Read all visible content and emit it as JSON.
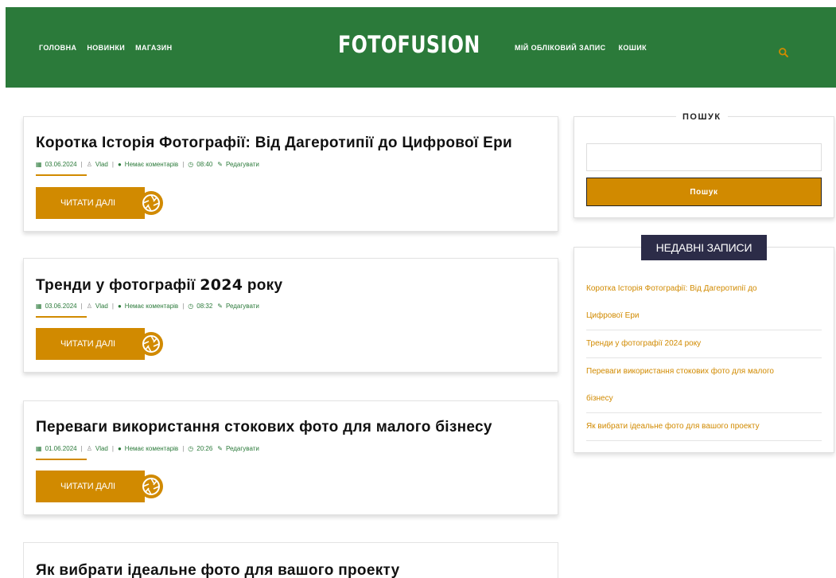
{
  "header": {
    "logo": "FOTOFUSION",
    "nav_left": [
      "ГОЛОВНА",
      "НОВИНКИ",
      "МАГАЗИН"
    ],
    "nav_right": [
      "МІЙ ОБЛІКОВИЙ ЗАПИС",
      "КОШИК"
    ],
    "accent_color": "#d18a00",
    "bg_color": "#2b7a3a"
  },
  "posts": [
    {
      "title": "Коротка Історія Фотографії: Від Дагеротипії до Цифрової Ери",
      "date": "03.06.2024",
      "author": "Vlad",
      "comments": "Немає коментарів",
      "time": "08:40",
      "edit": "Редагувати",
      "read_more": "ЧИТАТИ ДАЛІ"
    },
    {
      "title_pre": "Тренди у фотографії ",
      "title_year": "2024",
      "title_post": " року",
      "date": "03.06.2024",
      "author": "Vlad",
      "comments": "Немає коментарів",
      "time": "08:32",
      "edit": "Редагувати",
      "read_more": "ЧИТАТИ ДАЛІ"
    },
    {
      "title": "Переваги використання стокових фото для малого бізнесу",
      "date": "01.06.2024",
      "author": "Vlad",
      "comments": "Немає коментарів",
      "time": "20:26",
      "edit": "Редагувати",
      "read_more": "ЧИТАТИ ДАЛІ"
    },
    {
      "title": "Як вибрати ідеальне фото для вашого проекту"
    }
  ],
  "sidebar": {
    "search": {
      "heading": "ПОШУК",
      "placeholder": "",
      "button": "Пошук"
    },
    "recent": {
      "heading": "НЕДАВНІ ЗАПИСИ",
      "items": [
        [
          "Коротка Історія Фотографії: Від Дагеротипії до",
          "Цифрової Ери"
        ],
        [
          "Тренди у фотографії 2024 року"
        ],
        [
          "Переваги використання стокових фото для малого",
          "бізнесу"
        ],
        [
          "Як вибрати ідеальне фото для вашого проекту"
        ]
      ]
    }
  }
}
